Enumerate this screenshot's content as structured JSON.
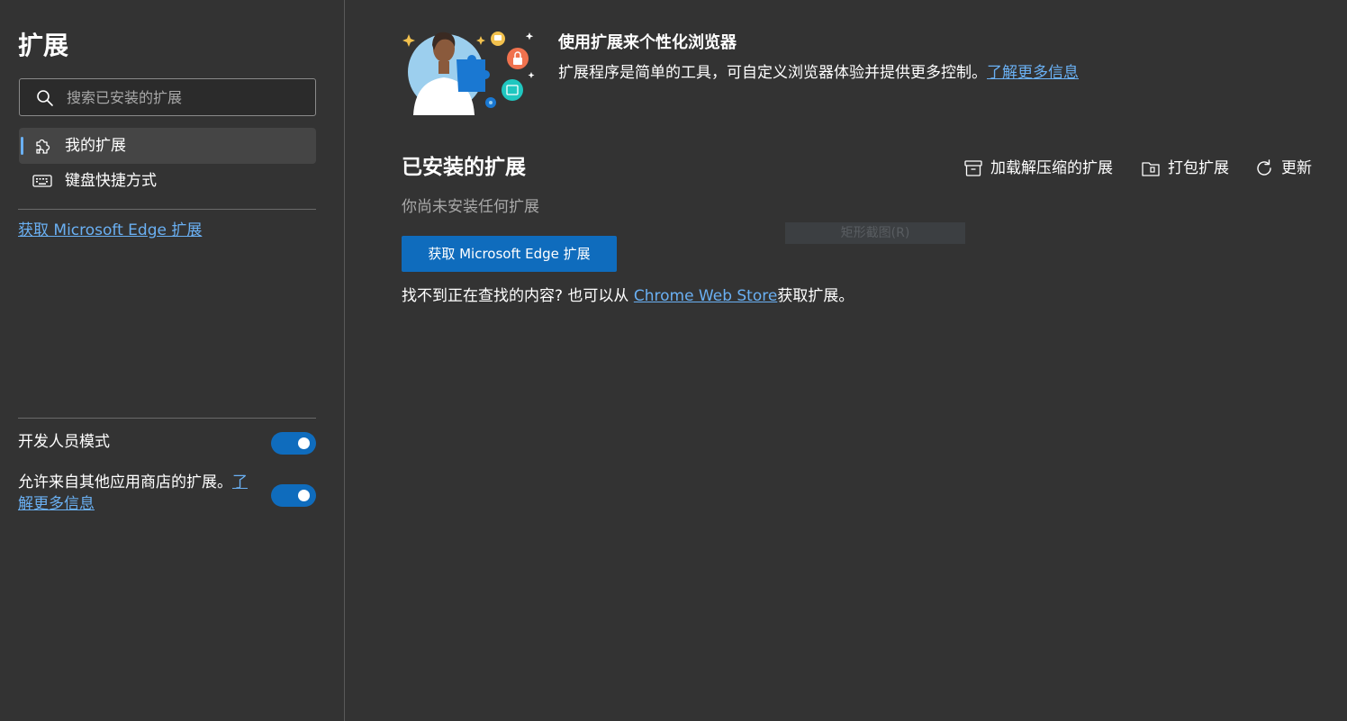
{
  "sidebar": {
    "title": "扩展",
    "search": {
      "placeholder": "搜索已安装的扩展",
      "value": ""
    },
    "nav": [
      {
        "label": "我的扩展",
        "icon": "puzzle-icon",
        "active": true
      },
      {
        "label": "键盘快捷方式",
        "icon": "keyboard-icon",
        "active": false
      }
    ],
    "store_link": "获取 Microsoft Edge 扩展",
    "developer_mode": {
      "label": "开发人员模式",
      "enabled": true
    },
    "other_stores": {
      "label": "允许来自其他应用商店的扩展。",
      "link": "了解更多信息",
      "enabled": true
    }
  },
  "banner": {
    "title": "使用扩展来个性化浏览器",
    "description": "扩展程序是简单的工具，可自定义浏览器体验并提供更多控制。",
    "link": "了解更多信息"
  },
  "installed": {
    "title": "已安装的扩展",
    "toolbar": {
      "load_unpacked": "加载解压缩的扩展",
      "pack": "打包扩展",
      "update": "更新"
    },
    "empty_message": "你尚未安装任何扩展",
    "get_button": "获取 Microsoft Edge 扩展",
    "hint_prefix": "找不到正在查找的内容? 也可以从",
    "hint_link": "Chrome Web Store",
    "hint_suffix": "获取扩展。"
  },
  "overlay_text": "矩形截图(R)",
  "colors": {
    "background": "#333333",
    "accent": "#0f6cbd",
    "link": "#6ab0f3",
    "nav_active_bg": "#454545"
  }
}
